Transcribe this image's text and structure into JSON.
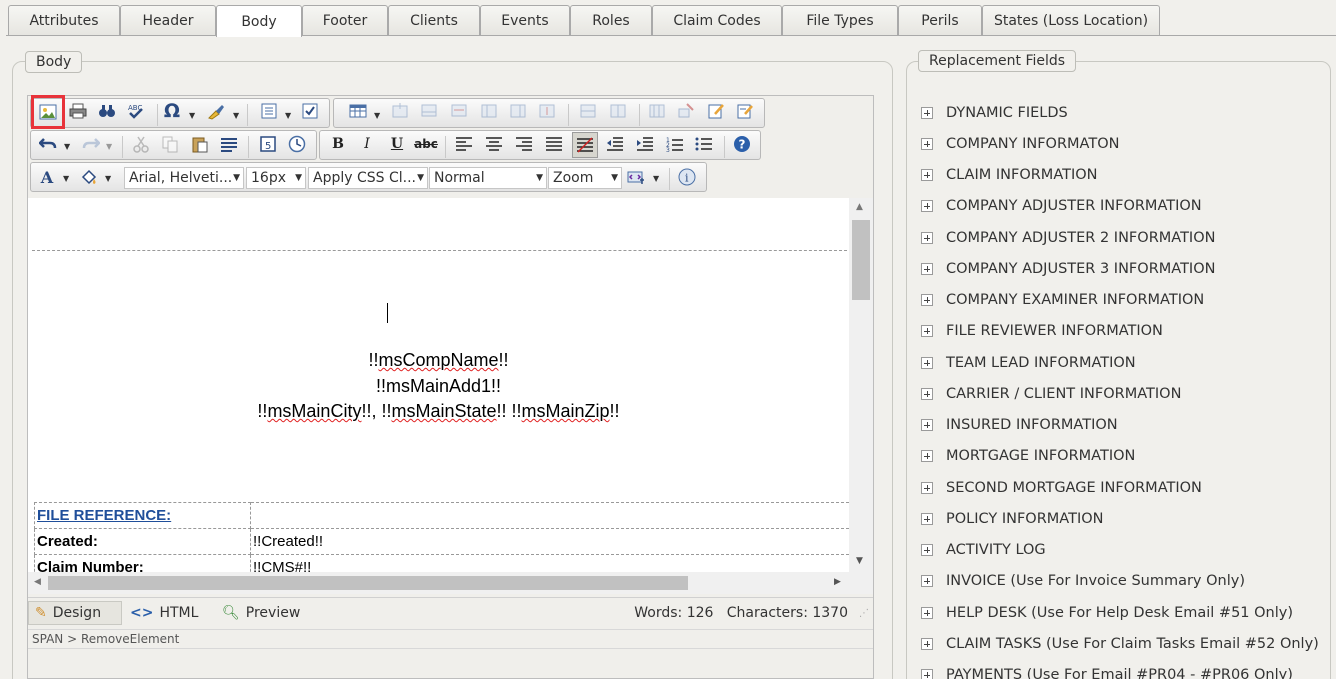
{
  "tabs": [
    "Attributes",
    "Header",
    "Body",
    "Footer",
    "Clients",
    "Events",
    "Roles",
    "Claim Codes",
    "File Types",
    "Perils",
    "States (Loss Location)"
  ],
  "active_tab": "Body",
  "body_legend": "Body",
  "fields_legend": "Replacement Fields",
  "toolbar": {
    "font_name": "Arial, Helveti...",
    "font_size": "16px",
    "css_class": "Apply CSS Cl...",
    "paragraph": "Normal",
    "zoom": "Zoom",
    "icons": {
      "row1": [
        "image-manager-icon",
        "print-icon",
        "find-replace-icon",
        "spell-check-icon",
        "special-char-icon",
        "format-stripper-icon",
        "module-manager-icon",
        "checkbox-icon",
        "insert-table-icon",
        "insert-row-above-icon",
        "insert-row-below-icon",
        "delete-row-icon",
        "insert-column-left-icon",
        "insert-column-right-icon",
        "delete-column-icon",
        "merge-cells-icon",
        "split-cell-icon",
        "cell-properties-icon",
        "table-properties-icon",
        "edit-properties-icon",
        "edit-template-icon"
      ],
      "row2": [
        "undo-icon",
        "redo-icon",
        "cut-icon",
        "copy-icon",
        "paste-icon",
        "paragraph-icon",
        "insert-date-icon",
        "insert-time-icon",
        "bold-icon",
        "italic-icon",
        "underline-icon",
        "strikethrough-icon",
        "align-left-icon",
        "align-center-icon",
        "align-right-icon",
        "justify-icon",
        "remove-alignment-icon",
        "outdent-icon",
        "indent-icon",
        "numbered-list-icon",
        "bullet-list-icon",
        "help-icon"
      ],
      "row3": [
        "foreground-color-icon",
        "background-color-icon",
        "insert-snippet-icon",
        "about-icon"
      ]
    }
  },
  "document": {
    "line1_prefix": "!!",
    "line1_field": "msCompName",
    "line1_suffix": "!!",
    "line2": "!!msMainAdd1!!",
    "line3_a": "!!",
    "line3_city": "msMainCity",
    "line3_b": "!!, !!",
    "line3_state": "msMainState",
    "line3_c": "!! !!",
    "line3_zip": "msMainZip",
    "line3_d": "!!",
    "table": [
      {
        "label": "FILE REFERENCE:",
        "value": ""
      },
      {
        "label": "Created:",
        "value": "!!Created!!"
      },
      {
        "label": "Claim Number:",
        "value": "!!CMS#!!"
      }
    ]
  },
  "modes": {
    "design": "Design",
    "html": "HTML",
    "preview": "Preview"
  },
  "status": {
    "words": "Words: 126",
    "characters": "Characters: 1370"
  },
  "path": "SPAN > RemoveElement",
  "replacement_fields": [
    "DYNAMIC FIELDS",
    "COMPANY INFORMATON",
    "CLAIM INFORMATION",
    "COMPANY ADJUSTER INFORMATION",
    "COMPANY ADJUSTER 2 INFORMATION",
    "COMPANY ADJUSTER 3 INFORMATION",
    "COMPANY EXAMINER INFORMATION",
    "FILE REVIEWER INFORMATION",
    "TEAM LEAD INFORMATION",
    "CARRIER / CLIENT INFORMATION",
    "INSURED INFORMATION",
    "MORTGAGE INFORMATION",
    "SECOND MORTGAGE INFORMATION",
    "POLICY INFORMATION",
    "ACTIVITY LOG",
    "INVOICE (Use For Invoice Summary Only)",
    "HELP DESK (Use For Help Desk Email #51 Only)",
    "CLAIM TASKS (Use For Claim Tasks Email #52 Only)",
    "PAYMENTS (Use For Email #PR04 - #PR06 Only)"
  ],
  "colors": {
    "highlight": "#e8333a",
    "link_blue": "#1f4e9a",
    "squiggle": "#e02020"
  }
}
